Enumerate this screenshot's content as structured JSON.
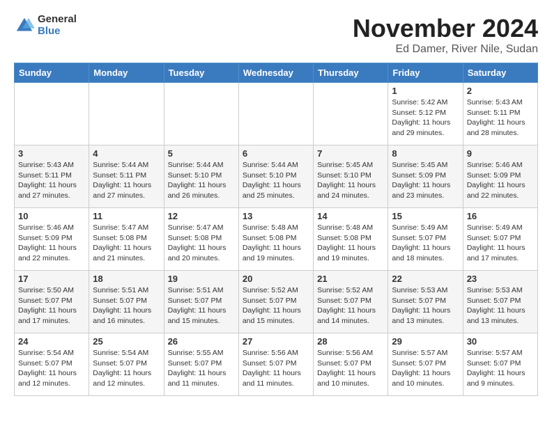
{
  "logo": {
    "general": "General",
    "blue": "Blue"
  },
  "header": {
    "month": "November 2024",
    "location": "Ed Damer, River Nile, Sudan"
  },
  "weekdays": [
    "Sunday",
    "Monday",
    "Tuesday",
    "Wednesday",
    "Thursday",
    "Friday",
    "Saturday"
  ],
  "weeks": [
    [
      {
        "day": "",
        "info": ""
      },
      {
        "day": "",
        "info": ""
      },
      {
        "day": "",
        "info": ""
      },
      {
        "day": "",
        "info": ""
      },
      {
        "day": "",
        "info": ""
      },
      {
        "day": "1",
        "info": "Sunrise: 5:42 AM\nSunset: 5:12 PM\nDaylight: 11 hours and 29 minutes."
      },
      {
        "day": "2",
        "info": "Sunrise: 5:43 AM\nSunset: 5:11 PM\nDaylight: 11 hours and 28 minutes."
      }
    ],
    [
      {
        "day": "3",
        "info": "Sunrise: 5:43 AM\nSunset: 5:11 PM\nDaylight: 11 hours and 27 minutes."
      },
      {
        "day": "4",
        "info": "Sunrise: 5:44 AM\nSunset: 5:11 PM\nDaylight: 11 hours and 27 minutes."
      },
      {
        "day": "5",
        "info": "Sunrise: 5:44 AM\nSunset: 5:10 PM\nDaylight: 11 hours and 26 minutes."
      },
      {
        "day": "6",
        "info": "Sunrise: 5:44 AM\nSunset: 5:10 PM\nDaylight: 11 hours and 25 minutes."
      },
      {
        "day": "7",
        "info": "Sunrise: 5:45 AM\nSunset: 5:10 PM\nDaylight: 11 hours and 24 minutes."
      },
      {
        "day": "8",
        "info": "Sunrise: 5:45 AM\nSunset: 5:09 PM\nDaylight: 11 hours and 23 minutes."
      },
      {
        "day": "9",
        "info": "Sunrise: 5:46 AM\nSunset: 5:09 PM\nDaylight: 11 hours and 22 minutes."
      }
    ],
    [
      {
        "day": "10",
        "info": "Sunrise: 5:46 AM\nSunset: 5:09 PM\nDaylight: 11 hours and 22 minutes."
      },
      {
        "day": "11",
        "info": "Sunrise: 5:47 AM\nSunset: 5:08 PM\nDaylight: 11 hours and 21 minutes."
      },
      {
        "day": "12",
        "info": "Sunrise: 5:47 AM\nSunset: 5:08 PM\nDaylight: 11 hours and 20 minutes."
      },
      {
        "day": "13",
        "info": "Sunrise: 5:48 AM\nSunset: 5:08 PM\nDaylight: 11 hours and 19 minutes."
      },
      {
        "day": "14",
        "info": "Sunrise: 5:48 AM\nSunset: 5:08 PM\nDaylight: 11 hours and 19 minutes."
      },
      {
        "day": "15",
        "info": "Sunrise: 5:49 AM\nSunset: 5:07 PM\nDaylight: 11 hours and 18 minutes."
      },
      {
        "day": "16",
        "info": "Sunrise: 5:49 AM\nSunset: 5:07 PM\nDaylight: 11 hours and 17 minutes."
      }
    ],
    [
      {
        "day": "17",
        "info": "Sunrise: 5:50 AM\nSunset: 5:07 PM\nDaylight: 11 hours and 17 minutes."
      },
      {
        "day": "18",
        "info": "Sunrise: 5:51 AM\nSunset: 5:07 PM\nDaylight: 11 hours and 16 minutes."
      },
      {
        "day": "19",
        "info": "Sunrise: 5:51 AM\nSunset: 5:07 PM\nDaylight: 11 hours and 15 minutes."
      },
      {
        "day": "20",
        "info": "Sunrise: 5:52 AM\nSunset: 5:07 PM\nDaylight: 11 hours and 15 minutes."
      },
      {
        "day": "21",
        "info": "Sunrise: 5:52 AM\nSunset: 5:07 PM\nDaylight: 11 hours and 14 minutes."
      },
      {
        "day": "22",
        "info": "Sunrise: 5:53 AM\nSunset: 5:07 PM\nDaylight: 11 hours and 13 minutes."
      },
      {
        "day": "23",
        "info": "Sunrise: 5:53 AM\nSunset: 5:07 PM\nDaylight: 11 hours and 13 minutes."
      }
    ],
    [
      {
        "day": "24",
        "info": "Sunrise: 5:54 AM\nSunset: 5:07 PM\nDaylight: 11 hours and 12 minutes."
      },
      {
        "day": "25",
        "info": "Sunrise: 5:54 AM\nSunset: 5:07 PM\nDaylight: 11 hours and 12 minutes."
      },
      {
        "day": "26",
        "info": "Sunrise: 5:55 AM\nSunset: 5:07 PM\nDaylight: 11 hours and 11 minutes."
      },
      {
        "day": "27",
        "info": "Sunrise: 5:56 AM\nSunset: 5:07 PM\nDaylight: 11 hours and 11 minutes."
      },
      {
        "day": "28",
        "info": "Sunrise: 5:56 AM\nSunset: 5:07 PM\nDaylight: 11 hours and 10 minutes."
      },
      {
        "day": "29",
        "info": "Sunrise: 5:57 AM\nSunset: 5:07 PM\nDaylight: 11 hours and 10 minutes."
      },
      {
        "day": "30",
        "info": "Sunrise: 5:57 AM\nSunset: 5:07 PM\nDaylight: 11 hours and 9 minutes."
      }
    ]
  ]
}
